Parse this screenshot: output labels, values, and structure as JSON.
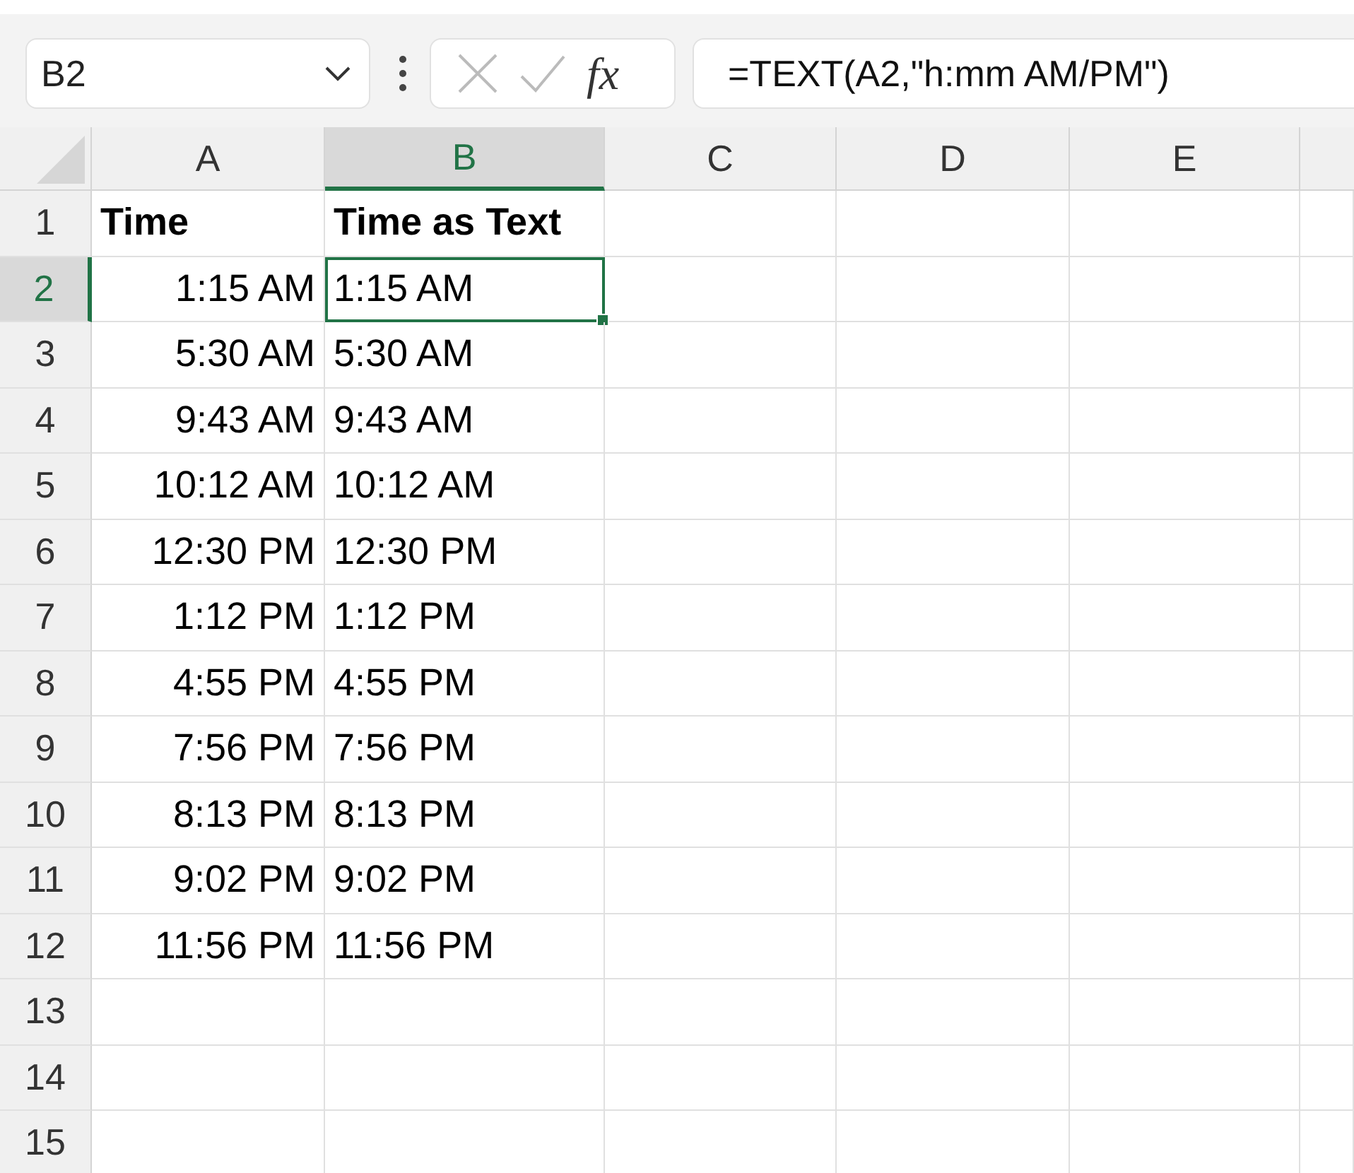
{
  "formula_bar": {
    "name_box": "B2",
    "function_label": "fx",
    "formula": "=TEXT(A2,\"h:mm AM/PM\")"
  },
  "columns": [
    {
      "label": "A",
      "selected": false
    },
    {
      "label": "B",
      "selected": true
    },
    {
      "label": "C",
      "selected": false
    },
    {
      "label": "D",
      "selected": false
    },
    {
      "label": "E",
      "selected": false
    }
  ],
  "rows": [
    {
      "number": "1",
      "selected": false,
      "cells": [
        {
          "text": "Time",
          "kind": "header",
          "selected": false
        },
        {
          "text": "Time as Text",
          "kind": "header",
          "selected": false
        }
      ]
    },
    {
      "number": "2",
      "selected": true,
      "cells": [
        {
          "text": "1:15 AM",
          "kind": "number",
          "selected": false
        },
        {
          "text": "1:15 AM",
          "kind": "text",
          "selected": true
        }
      ]
    },
    {
      "number": "3",
      "selected": false,
      "cells": [
        {
          "text": "5:30 AM",
          "kind": "number",
          "selected": false
        },
        {
          "text": "5:30 AM",
          "kind": "text",
          "selected": false
        }
      ]
    },
    {
      "number": "4",
      "selected": false,
      "cells": [
        {
          "text": "9:43 AM",
          "kind": "number",
          "selected": false
        },
        {
          "text": "9:43 AM",
          "kind": "text",
          "selected": false
        }
      ]
    },
    {
      "number": "5",
      "selected": false,
      "cells": [
        {
          "text": "10:12 AM",
          "kind": "number",
          "selected": false
        },
        {
          "text": "10:12 AM",
          "kind": "text",
          "selected": false
        }
      ]
    },
    {
      "number": "6",
      "selected": false,
      "cells": [
        {
          "text": "12:30 PM",
          "kind": "number",
          "selected": false
        },
        {
          "text": "12:30 PM",
          "kind": "text",
          "selected": false
        }
      ]
    },
    {
      "number": "7",
      "selected": false,
      "cells": [
        {
          "text": "1:12 PM",
          "kind": "number",
          "selected": false
        },
        {
          "text": "1:12 PM",
          "kind": "text",
          "selected": false
        }
      ]
    },
    {
      "number": "8",
      "selected": false,
      "cells": [
        {
          "text": "4:55 PM",
          "kind": "number",
          "selected": false
        },
        {
          "text": "4:55 PM",
          "kind": "text",
          "selected": false
        }
      ]
    },
    {
      "number": "9",
      "selected": false,
      "cells": [
        {
          "text": "7:56 PM",
          "kind": "number",
          "selected": false
        },
        {
          "text": "7:56 PM",
          "kind": "text",
          "selected": false
        }
      ]
    },
    {
      "number": "10",
      "selected": false,
      "cells": [
        {
          "text": "8:13 PM",
          "kind": "number",
          "selected": false
        },
        {
          "text": "8:13 PM",
          "kind": "text",
          "selected": false
        }
      ]
    },
    {
      "number": "11",
      "selected": false,
      "cells": [
        {
          "text": "9:02 PM",
          "kind": "number",
          "selected": false
        },
        {
          "text": "9:02 PM",
          "kind": "text",
          "selected": false
        }
      ]
    },
    {
      "number": "12",
      "selected": false,
      "cells": [
        {
          "text": "11:56 PM",
          "kind": "number",
          "selected": false
        },
        {
          "text": "11:56 PM",
          "kind": "text",
          "selected": false
        }
      ]
    },
    {
      "number": "13",
      "selected": false,
      "cells": []
    },
    {
      "number": "14",
      "selected": false,
      "cells": []
    },
    {
      "number": "15",
      "selected": false,
      "cells": []
    }
  ]
}
